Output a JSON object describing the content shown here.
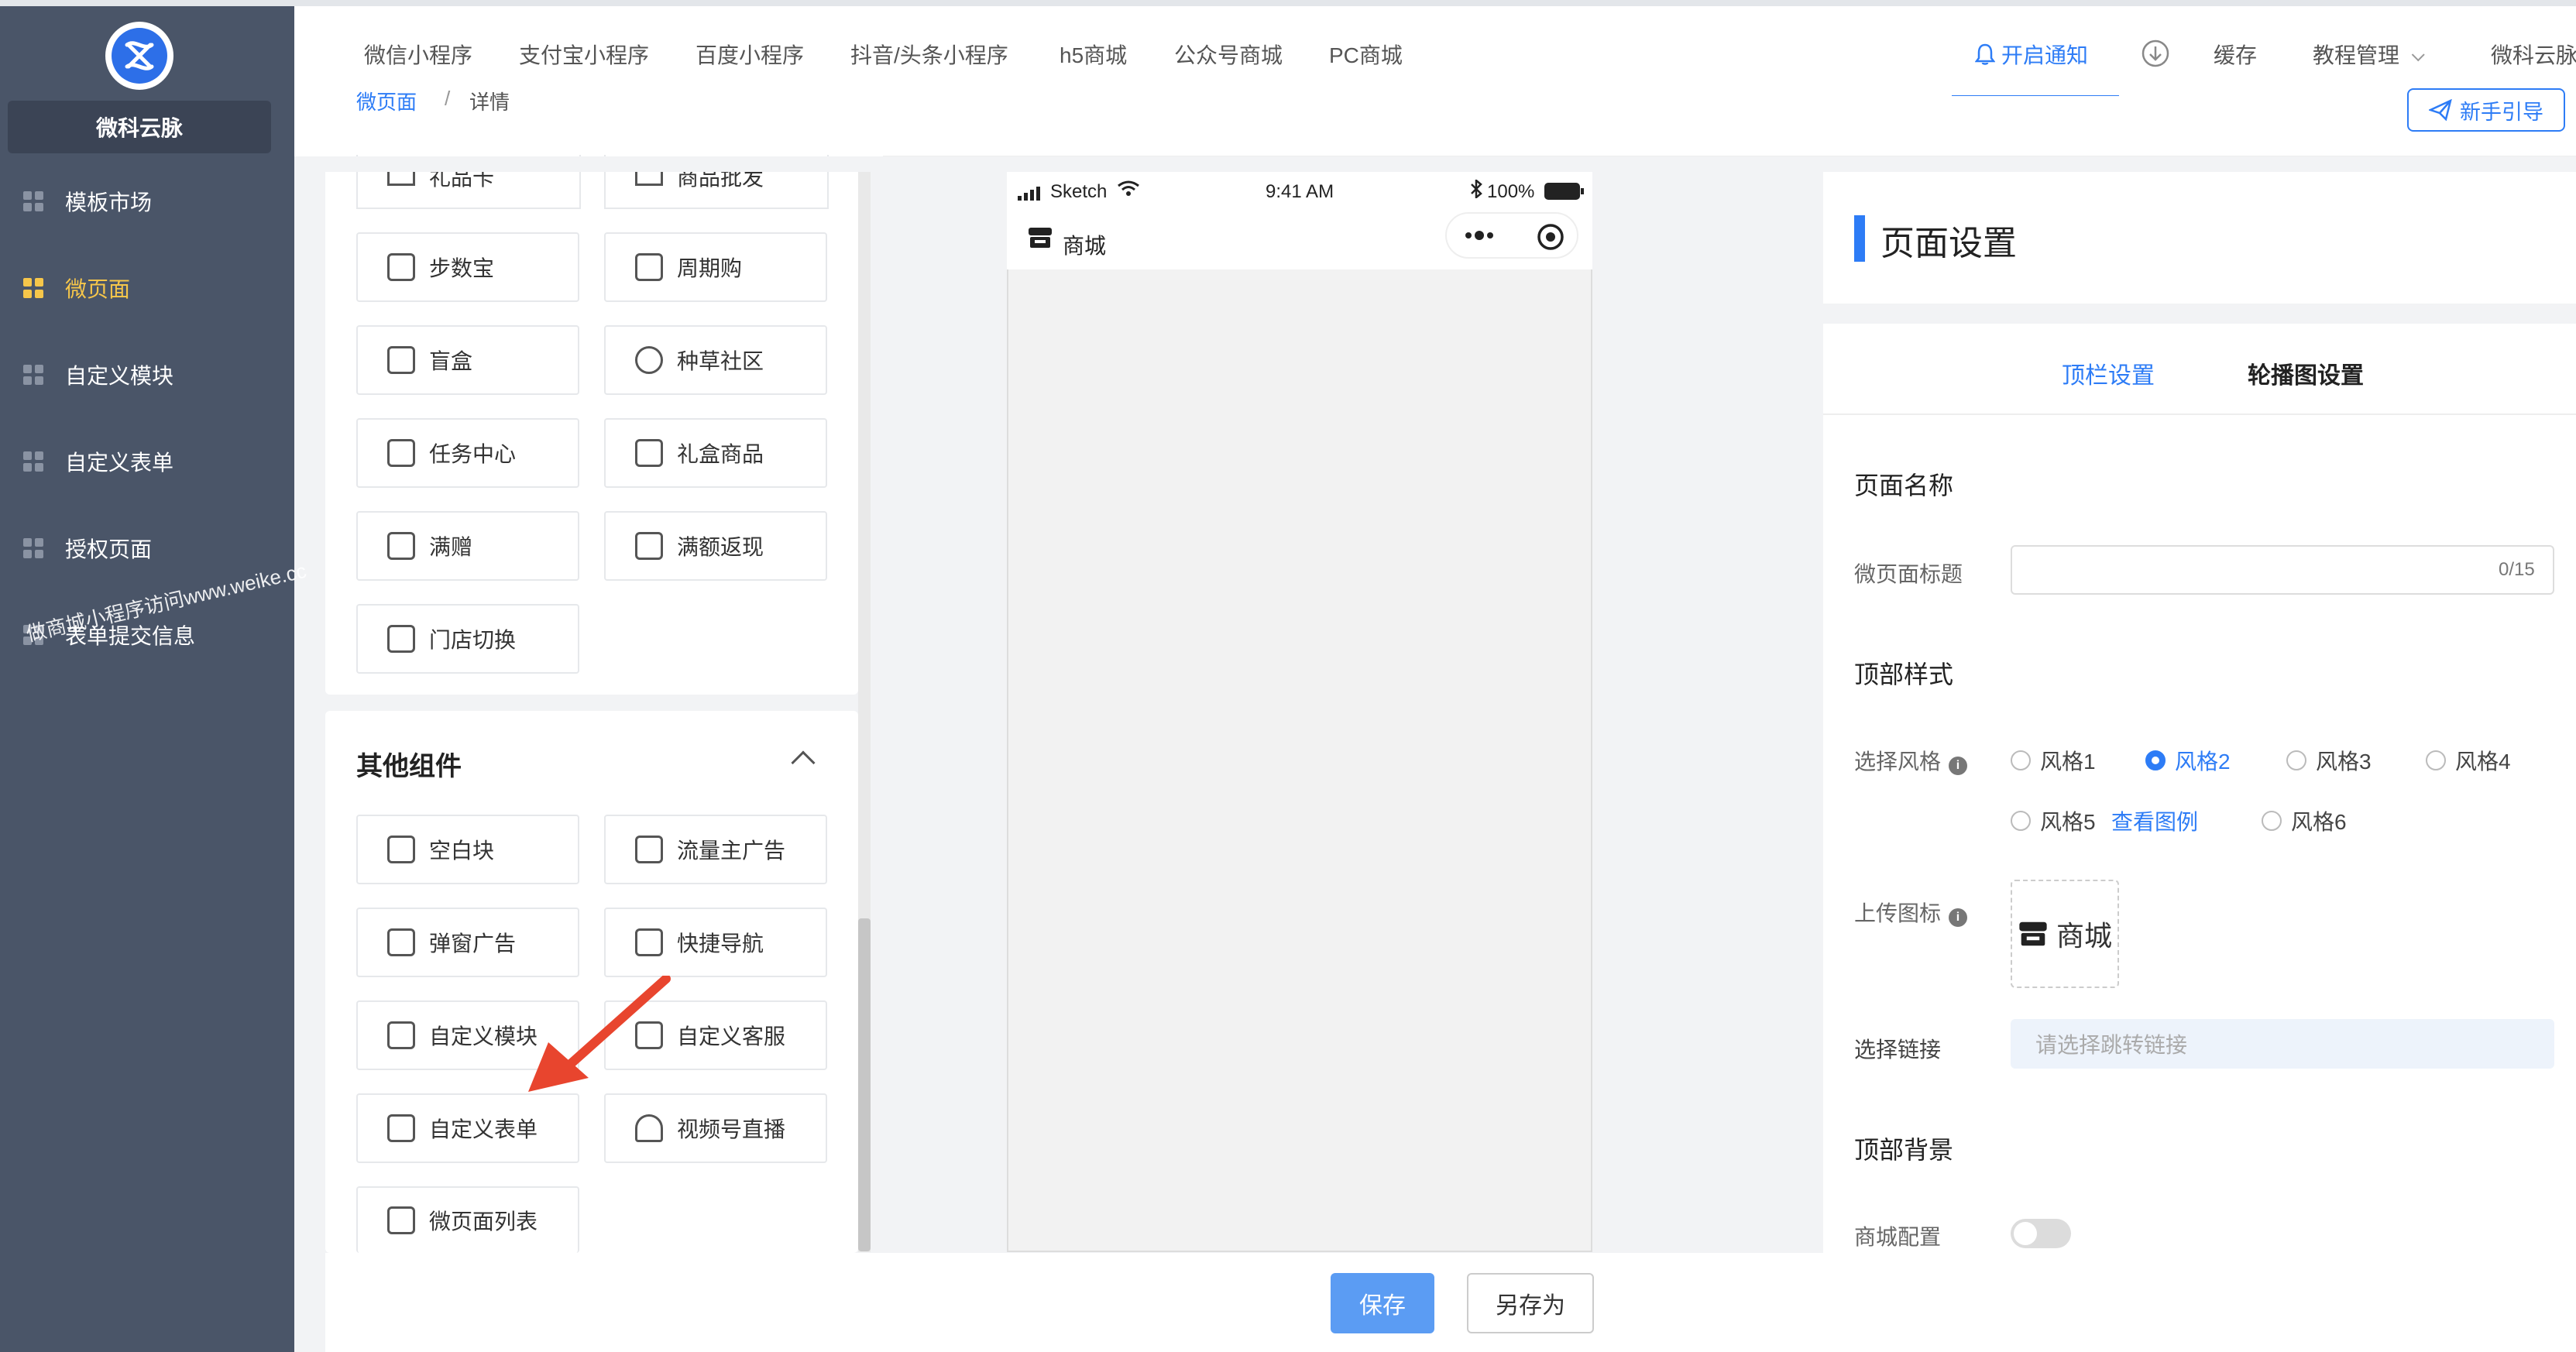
{
  "colors": {
    "sidebar": "#4a5568",
    "accent": "#2d7cf6",
    "active_nav": "#f6c64a",
    "arrow": "#e8452e"
  },
  "sidebar": {
    "brand": "微科云脉",
    "items": [
      {
        "label": "模板市场",
        "icon": "grid-icon"
      },
      {
        "label": "微页面",
        "icon": "grid-icon",
        "active": true
      },
      {
        "label": "自定义模块",
        "icon": "grid-icon"
      },
      {
        "label": "自定义表单",
        "icon": "grid-icon"
      },
      {
        "label": "授权页面",
        "icon": "grid-icon"
      },
      {
        "label": "表单提交信息",
        "icon": "grid-icon"
      }
    ],
    "watermark": "做商城小程序访问www.weike.cc"
  },
  "header": {
    "tabs": [
      "微信小程序",
      "支付宝小程序",
      "百度小程序",
      "抖音/头条小程序",
      "h5商城",
      "公众号商城",
      "PC商城"
    ],
    "notice": "开启通知",
    "cache": "缓存",
    "tutorial": "教程管理",
    "user": "微科云脉"
  },
  "breadcrumb": {
    "link": "微页面",
    "separator": "/",
    "current": "详情"
  },
  "guide_button": "新手引导",
  "components_top": [
    {
      "label": "礼品卡",
      "icon": "gift-card-icon"
    },
    {
      "label": "商品批发",
      "icon": "wholesale-icon"
    },
    {
      "label": "步数宝",
      "icon": "shoe-icon"
    },
    {
      "label": "周期购",
      "icon": "calendar-icon"
    },
    {
      "label": "盲盒",
      "icon": "box-icon"
    },
    {
      "label": "种草社区",
      "icon": "community-icon"
    },
    {
      "label": "任务中心",
      "icon": "task-icon"
    },
    {
      "label": "礼盒商品",
      "icon": "gift-box-icon"
    },
    {
      "label": "满赠",
      "icon": "gift-icon"
    },
    {
      "label": "满额返现",
      "icon": "cashback-icon"
    },
    {
      "label": "门店切换",
      "icon": "store-icon"
    }
  ],
  "other_section": {
    "title": "其他组件",
    "items": [
      {
        "label": "空白块",
        "icon": "blank-icon"
      },
      {
        "label": "流量主广告",
        "icon": "ad-icon"
      },
      {
        "label": "弹窗广告",
        "icon": "popup-icon"
      },
      {
        "label": "快捷导航",
        "icon": "nav-icon"
      },
      {
        "label": "自定义模块",
        "icon": "layout-icon"
      },
      {
        "label": "自定义客服",
        "icon": "qr-icon"
      },
      {
        "label": "自定义表单",
        "icon": "form-icon"
      },
      {
        "label": "视频号直播",
        "icon": "live-icon"
      },
      {
        "label": "微页面列表",
        "icon": "list-icon"
      }
    ]
  },
  "phone": {
    "carrier": "Sketch",
    "time": "9:41 AM",
    "battery": "100%",
    "title": "商城"
  },
  "settings": {
    "title": "页面设置",
    "tabs": [
      "顶栏设置",
      "轮播图设置"
    ],
    "page_name_heading": "页面名称",
    "page_title_label": "微页面标题",
    "page_title_counter": "0/15",
    "top_style_heading": "顶部样式",
    "style_label": "选择风格",
    "styles": [
      "风格1",
      "风格2",
      "风格3",
      "风格4",
      "风格5",
      "风格6"
    ],
    "selected_style": "风格2",
    "view_example": "查看图例",
    "upload_label": "上传图标",
    "upload_preview": "商城",
    "link_label": "选择链接",
    "link_placeholder": "请选择跳转链接",
    "top_bg_heading": "顶部背景",
    "mall_config_label": "商城配置"
  },
  "footer": {
    "save": "保存",
    "save_as": "另存为"
  }
}
